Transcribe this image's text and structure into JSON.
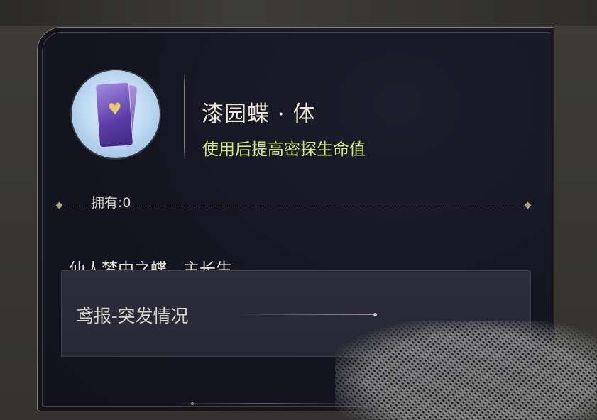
{
  "item": {
    "name": "漆园蝶 · 体",
    "effect": "使用后提高密探生命值",
    "owned_label": "拥有:0",
    "description": "仙人梦中之蝶，主长生。",
    "icon": "purple-card-heart-icon"
  },
  "source": {
    "label": "鸢报-突发情况"
  },
  "colors": {
    "panel_bg": "#151522",
    "border_gold": "#8a7d62",
    "effect_green": "#d5e97a",
    "title_text": "#eee8d6"
  }
}
